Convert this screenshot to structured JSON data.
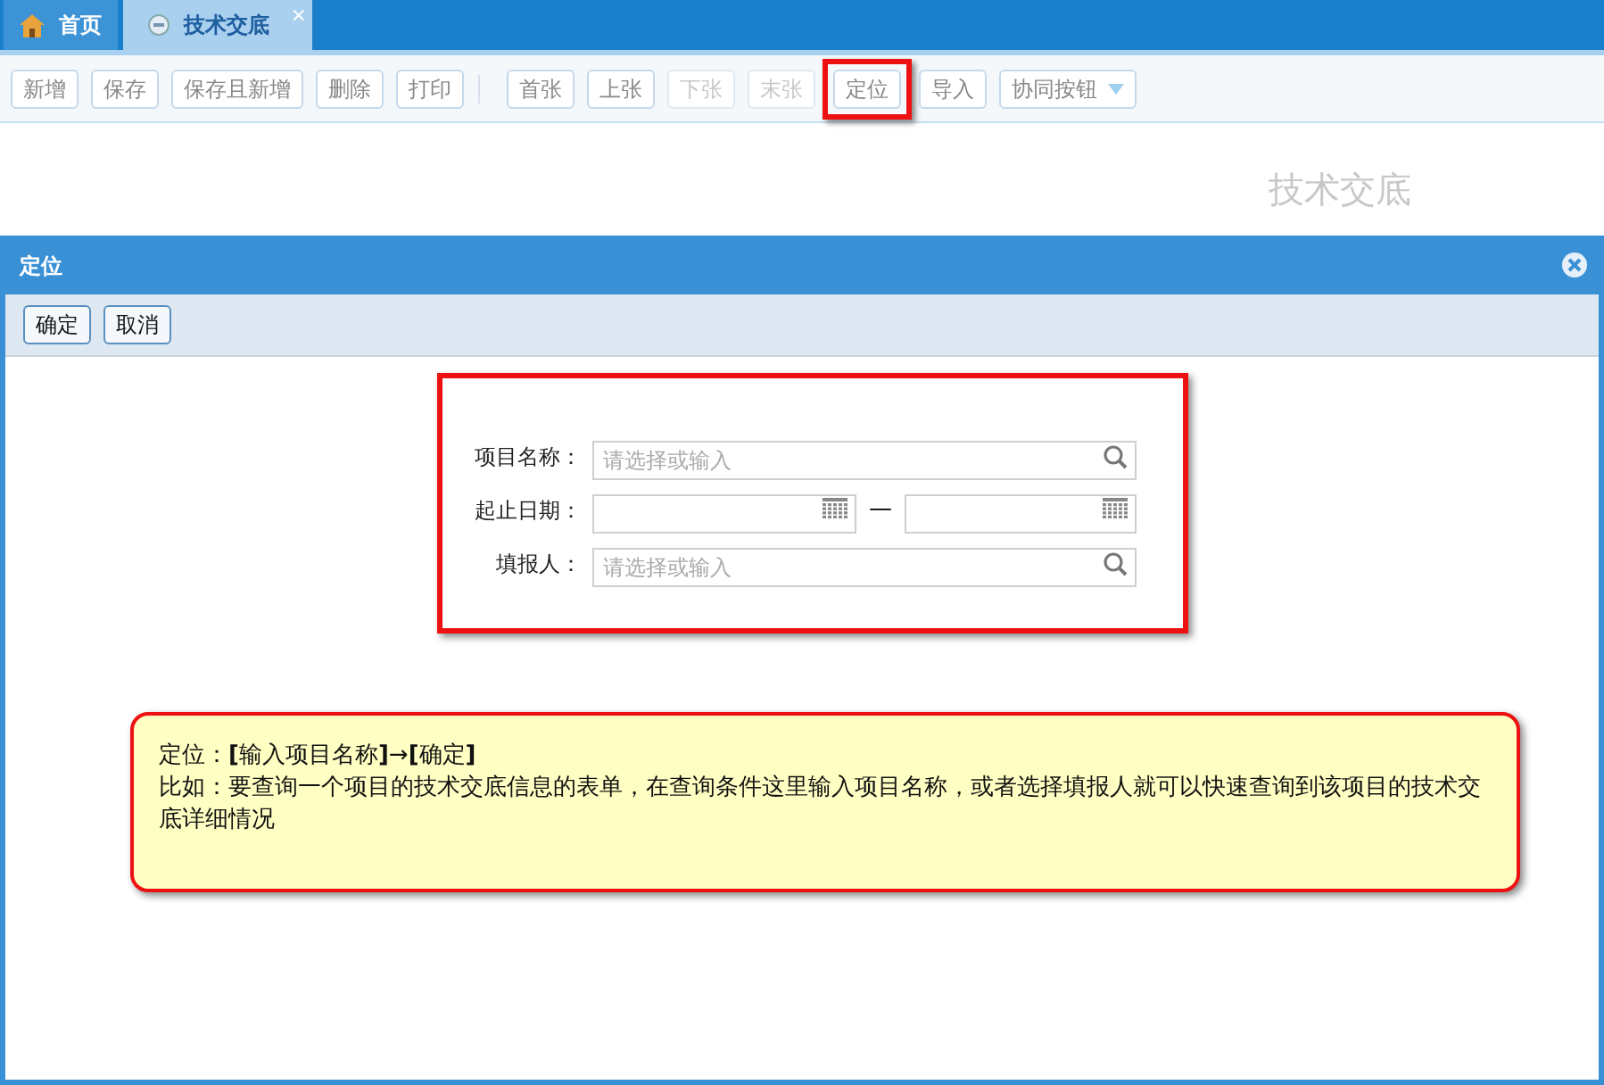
{
  "tabs": [
    {
      "label": "首页",
      "kind": "home",
      "selected": false
    },
    {
      "label": "技术交底",
      "kind": "page",
      "selected": true,
      "close": "×"
    }
  ],
  "toolbar": {
    "groups": [
      [
        {
          "label": "新增",
          "disabled": false,
          "highlighted": false
        },
        {
          "label": "保存",
          "disabled": false,
          "highlighted": false
        },
        {
          "label": "保存且新增",
          "disabled": false,
          "highlighted": false
        },
        {
          "label": "删除",
          "disabled": false,
          "highlighted": false
        },
        {
          "label": "打印",
          "disabled": false,
          "highlighted": false
        }
      ],
      [
        {
          "label": "首张",
          "disabled": false,
          "highlighted": false
        },
        {
          "label": "上张",
          "disabled": false,
          "highlighted": false
        },
        {
          "label": "下张",
          "disabled": true,
          "highlighted": false
        },
        {
          "label": "末张",
          "disabled": true,
          "highlighted": false
        },
        {
          "label": "定位",
          "disabled": false,
          "highlighted": true
        },
        {
          "label": "导入",
          "disabled": false,
          "highlighted": false
        },
        {
          "label": "协同按钮",
          "disabled": false,
          "highlighted": false,
          "dropdown": true
        }
      ]
    ]
  },
  "page_title": "技术交底",
  "dialog": {
    "title": "定位",
    "buttons": [
      "确定",
      "取消"
    ],
    "fields": [
      {
        "label": "项目名称：",
        "kind": "search",
        "placeholder": "请选择或输入"
      },
      {
        "label": "起止日期：",
        "kind": "daterange",
        "separator": "—"
      },
      {
        "label": "填报人：",
        "kind": "search",
        "placeholder": "请选择或输入"
      }
    ]
  },
  "callout": {
    "lines": [
      "定位：**[**输入项目名称**]**→**[**确定**]**",
      "比如：要查询一个项目的技术交底信息的表单，在查询条件这里输入项目名称，或者选择填报人就可以快速查询到该项目的技术交底详细情况"
    ]
  }
}
